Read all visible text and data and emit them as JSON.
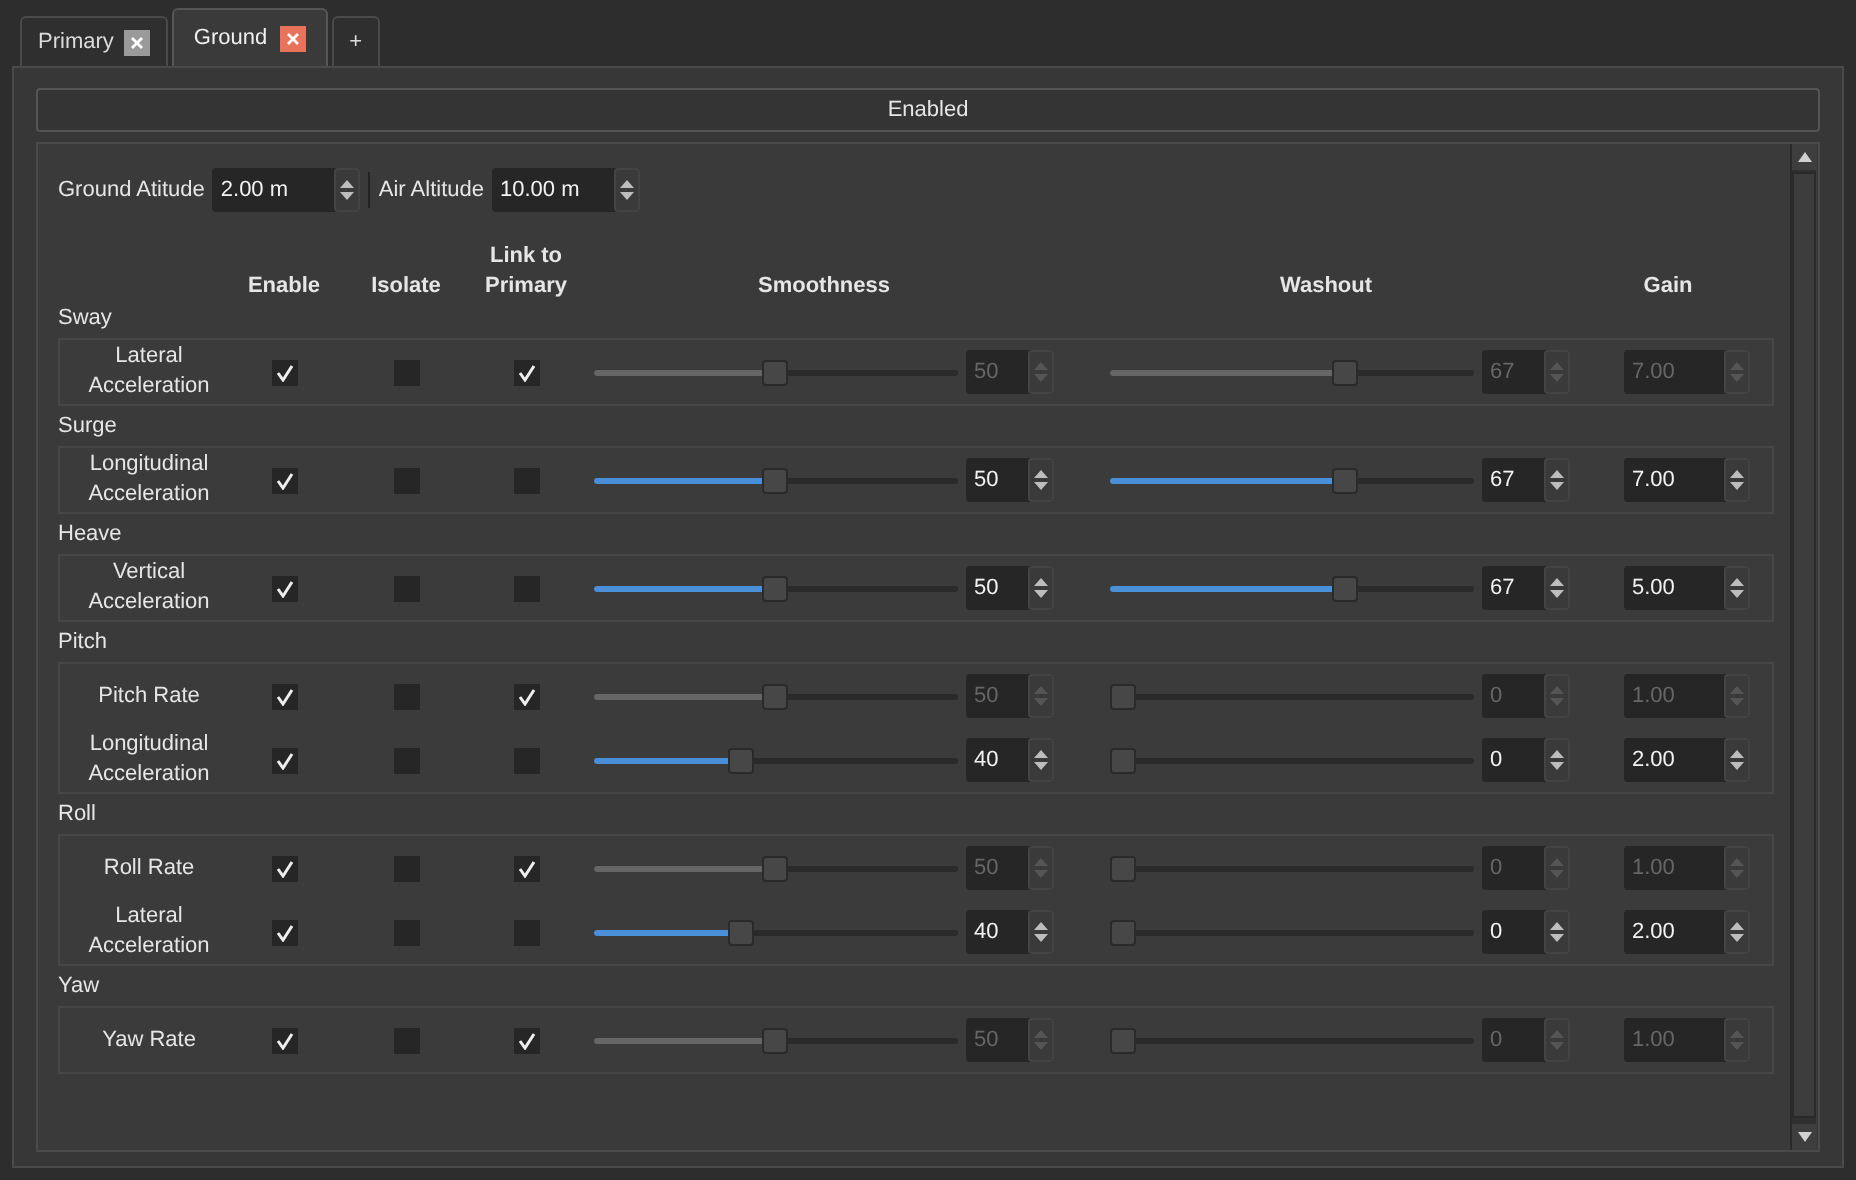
{
  "tabs": [
    {
      "label": "Primary",
      "selected": false,
      "closable": true
    },
    {
      "label": "Ground",
      "selected": true,
      "closable": true
    },
    {
      "label": "+",
      "selected": false,
      "closable": false
    }
  ],
  "enabled_button": "Enabled",
  "altitudes": [
    {
      "label": "Ground Atitude",
      "value": "2.00 m"
    },
    {
      "label": "Air Altitude",
      "value": "10.00 m"
    }
  ],
  "columns": [
    "Enable",
    "Isolate",
    "Link to Primary",
    "Smoothness",
    "Washout",
    "Gain"
  ],
  "groups": [
    {
      "label": "Sway",
      "rows": [
        {
          "label": "Lateral Acceleration",
          "enable": true,
          "isolate": false,
          "link_to_primary": true,
          "disabled": true,
          "smoothness": {
            "level": 0.5,
            "value": "50"
          },
          "washout": {
            "level": 0.66,
            "value": "67"
          },
          "gain": "7.00"
        }
      ]
    },
    {
      "label": "Surge",
      "rows": [
        {
          "label": "Longitudinal Acceleration",
          "enable": true,
          "isolate": false,
          "link_to_primary": false,
          "disabled": false,
          "smoothness": {
            "level": 0.5,
            "value": "50"
          },
          "washout": {
            "level": 0.66,
            "value": "67"
          },
          "gain": "7.00"
        }
      ]
    },
    {
      "label": "Heave",
      "rows": [
        {
          "label": "Vertical Acceleration",
          "enable": true,
          "isolate": false,
          "link_to_primary": false,
          "disabled": false,
          "smoothness": {
            "level": 0.5,
            "value": "50"
          },
          "washout": {
            "level": 0.66,
            "value": "67"
          },
          "gain": "5.00"
        }
      ]
    },
    {
      "label": "Pitch",
      "rows": [
        {
          "label": "Pitch Rate",
          "enable": true,
          "isolate": false,
          "link_to_primary": true,
          "disabled": true,
          "smoothness": {
            "level": 0.5,
            "value": "50"
          },
          "washout": {
            "level": 0,
            "value": "0"
          },
          "gain": "1.00"
        },
        {
          "label": "Longitudinal Acceleration",
          "enable": true,
          "isolate": false,
          "link_to_primary": false,
          "disabled": false,
          "smoothness": {
            "level": 0.4,
            "value": "40"
          },
          "washout": {
            "level": 0,
            "value": "0"
          },
          "gain": "2.00"
        }
      ]
    },
    {
      "label": "Roll",
      "rows": [
        {
          "label": "Roll Rate",
          "enable": true,
          "isolate": false,
          "link_to_primary": true,
          "disabled": true,
          "smoothness": {
            "level": 0.5,
            "value": "50"
          },
          "washout": {
            "level": 0,
            "value": "0"
          },
          "gain": "1.00"
        },
        {
          "label": "Lateral Acceleration",
          "enable": true,
          "isolate": false,
          "link_to_primary": false,
          "disabled": false,
          "smoothness": {
            "level": 0.4,
            "value": "40"
          },
          "washout": {
            "level": 0,
            "value": "0"
          },
          "gain": "2.00"
        }
      ]
    },
    {
      "label": "Yaw",
      "rows": [
        {
          "label": "Yaw Rate",
          "enable": true,
          "isolate": false,
          "link_to_primary": true,
          "disabled": true,
          "smoothness": {
            "level": 0.5,
            "value": "50"
          },
          "washout": {
            "level": 0,
            "value": "0"
          },
          "gain": "1.00"
        }
      ]
    }
  ]
}
